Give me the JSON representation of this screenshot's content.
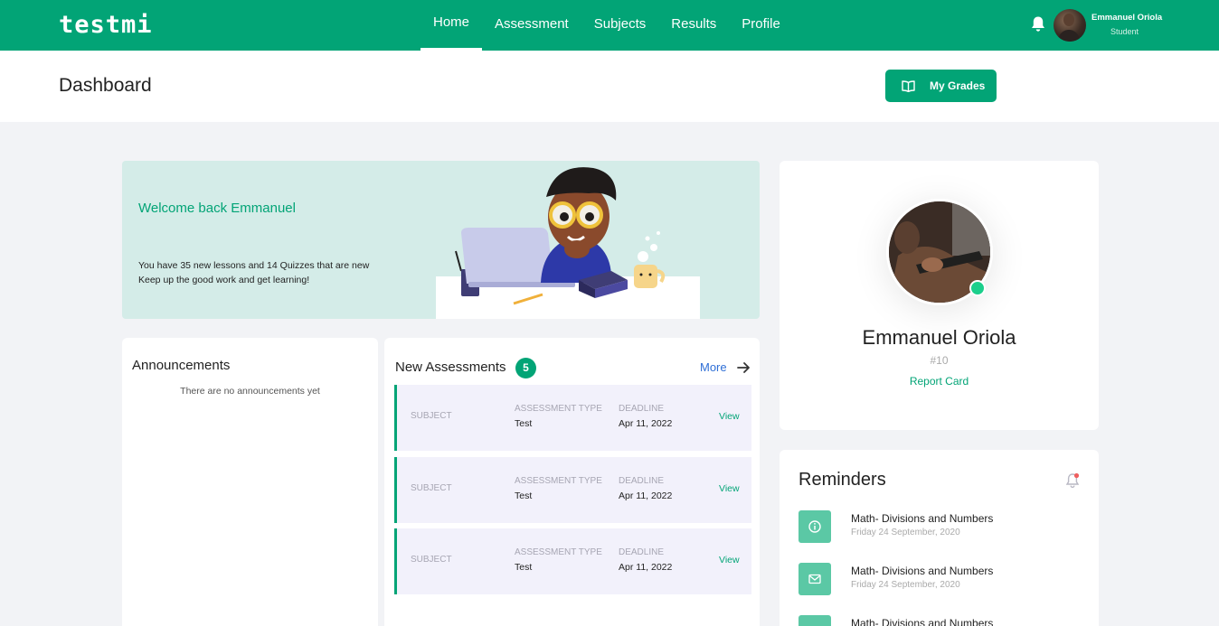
{
  "header": {
    "logo": "testmi",
    "nav": [
      "Home",
      "Assessment",
      "Subjects",
      "Results",
      "Profile"
    ],
    "user_name": "Emmanuel Oriola",
    "user_role": "Student"
  },
  "subheader": {
    "title": "Dashboard",
    "grades_button": "My Grades"
  },
  "welcome": {
    "title": "Welcome back Emmanuel",
    "line1": "You have 35 new lessons and 14 Quizzes that are new",
    "line2": "Keep up the good work and get learning!"
  },
  "announcements": {
    "title": "Announcements",
    "empty": "There are no announcements yet"
  },
  "assessments": {
    "title": "New Assessments",
    "count": "5",
    "more": "More",
    "rows": [
      {
        "subject_label": "SUBJECT",
        "type_label": "ASSESSMENT TYPE",
        "type": "Test",
        "deadline_label": "DEADLINE",
        "deadline": "Apr 11, 2022",
        "view": "View"
      },
      {
        "subject_label": "SUBJECT",
        "type_label": "ASSESSMENT TYPE",
        "type": "Test",
        "deadline_label": "DEADLINE",
        "deadline": "Apr 11, 2022",
        "view": "View"
      },
      {
        "subject_label": "SUBJECT",
        "type_label": "ASSESSMENT TYPE",
        "type": "Test",
        "deadline_label": "DEADLINE",
        "deadline": "Apr 11, 2022",
        "view": "View"
      }
    ]
  },
  "profile": {
    "name": "Emmanuel Oriola",
    "rank": "#10",
    "report_card": "Report Card"
  },
  "reminders": {
    "title": "Reminders",
    "items": [
      {
        "icon": "info-icon",
        "title": "Math- Divisions and Numbers",
        "date": "Friday 24 September, 2020"
      },
      {
        "icon": "mail-icon",
        "title": "Math- Divisions and Numbers",
        "date": "Friday 24 September, 2020"
      },
      {
        "icon": "calendar-icon",
        "title": "Math- Divisions and Numbers",
        "date": ""
      }
    ]
  },
  "colors": {
    "brand": "#02a476",
    "banner_bg": "#d4ece8",
    "row_bg": "#f2f1fb",
    "link_blue": "#2f6fd6",
    "reminder_icon_bg": "#5bc8a5"
  }
}
